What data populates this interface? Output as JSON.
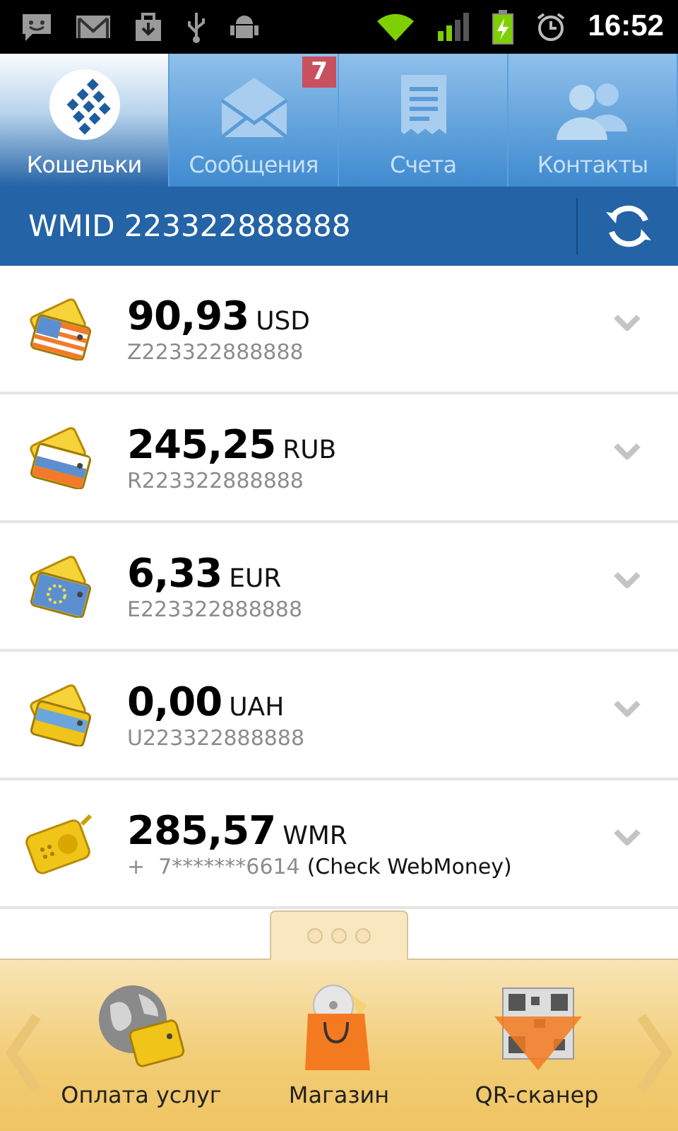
{
  "status_bar": {
    "time": "16:52"
  },
  "tabs": [
    {
      "kind": "wallets",
      "label": "Кошельки",
      "selected": true
    },
    {
      "kind": "messages",
      "label": "Сообщения",
      "selected": false,
      "badge": "7"
    },
    {
      "kind": "invoices",
      "label": "Счета",
      "selected": false
    },
    {
      "kind": "contacts",
      "label": "Контакты",
      "selected": false
    }
  ],
  "wmid": "WMID 223322888888",
  "purses": [
    {
      "kind": "usd",
      "amount": "90,93",
      "currency": "USD",
      "number": "Z223322888888"
    },
    {
      "kind": "rub",
      "amount": "245,25",
      "currency": "RUB",
      "number": "R223322888888"
    },
    {
      "kind": "eur",
      "amount": "6,33",
      "currency": "EUR",
      "number": "E223322888888"
    },
    {
      "kind": "uah",
      "amount": "0,00",
      "currency": "UAH",
      "number": "U223322888888"
    },
    {
      "kind": "wmr",
      "amount": "285,57",
      "currency": "WMR",
      "number": "+  7*******6614",
      "note": "(Check WebMoney)"
    }
  ],
  "drawer": {
    "items": [
      {
        "kind": "payments",
        "label": "Оплата услуг"
      },
      {
        "kind": "shop",
        "label": "Магазин"
      },
      {
        "kind": "qr",
        "label": "QR-сканер"
      }
    ]
  }
}
